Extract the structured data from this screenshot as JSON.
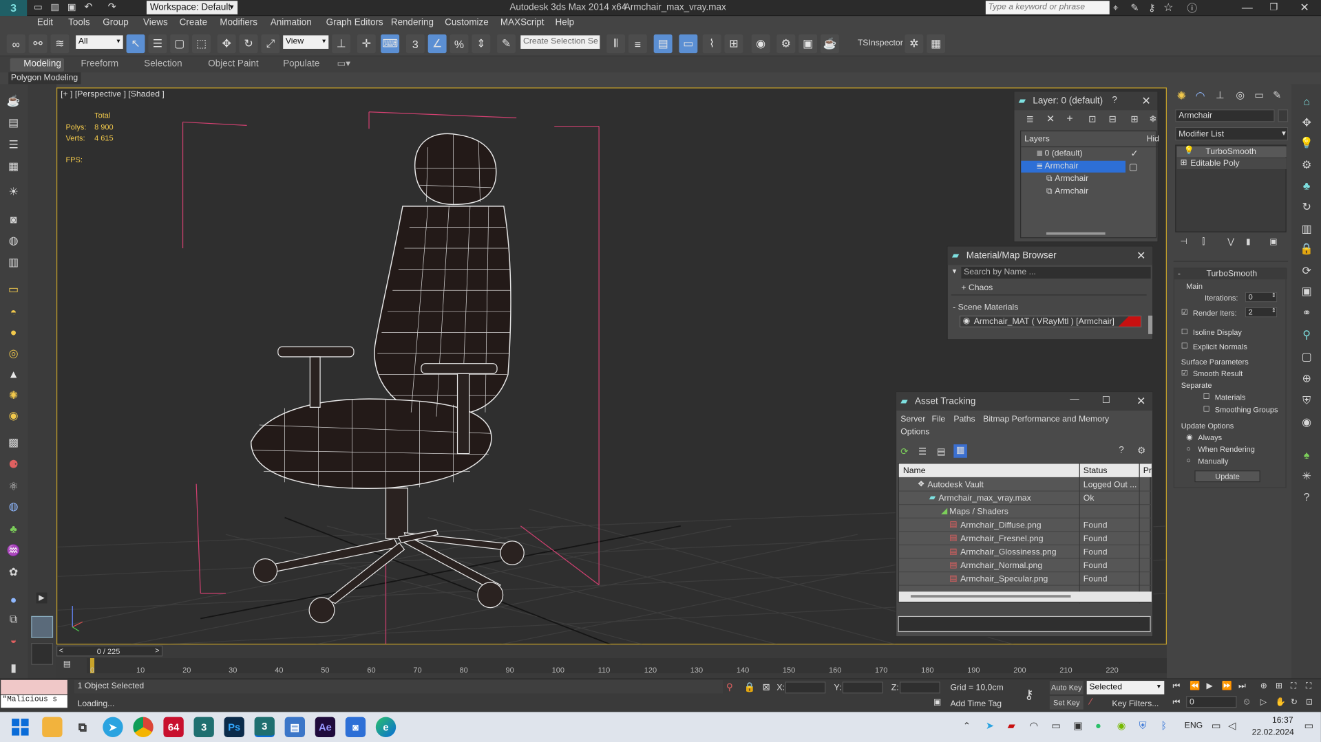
{
  "app": {
    "workspace_label": "Workspace: Default",
    "window_title": "Autodesk 3ds Max  2014 x64",
    "file_title": "Armchair_max_vray.max",
    "search_placeholder": "Type a keyword or phrase"
  },
  "menu": [
    "Edit",
    "Tools",
    "Group",
    "Views",
    "Create",
    "Modifiers",
    "Animation",
    "Graph Editors",
    "Rendering",
    "Customize",
    "MAXScript",
    "Help"
  ],
  "toolbar": {
    "selection_filter": "All",
    "ref_coord": "View",
    "selection_set": "Create Selection Se",
    "tsinspector": "TSInspector"
  },
  "ribbon": {
    "tabs": [
      "Modeling",
      "Freeform",
      "Selection",
      "Object Paint",
      "Populate"
    ],
    "sub_label": "Polygon Modeling"
  },
  "viewport": {
    "label": "[+ ] [Perspective ] [Shaded ]",
    "stats_total": "Total",
    "polys_label": "Polys:",
    "polys_value": "8 900",
    "verts_label": "Verts:",
    "verts_value": "4 615",
    "fps_label": "FPS:"
  },
  "layer_panel": {
    "title": "Layer: 0 (default)",
    "help": "?",
    "col_layers": "Layers",
    "col_hide": "Hid",
    "items": [
      "0 (default)",
      "Armchair",
      "Armchair",
      "Armchair"
    ]
  },
  "material_browser": {
    "title": "Material/Map Browser",
    "search_placeholder": "Search by Name ...",
    "group_chaos": "+ Chaos",
    "group_scene": "- Scene Materials",
    "material_item": "Armchair_MAT ( VRayMtl ) [Armchair]"
  },
  "asset_tracking": {
    "title": "Asset Tracking",
    "menu": [
      "Server",
      "File",
      "Paths",
      "Bitmap Performance and Memory"
    ],
    "menu_options": "Options",
    "col_name": "Name",
    "col_status": "Status",
    "col_pr": "Pr",
    "rows": [
      {
        "name": "Autodesk Vault",
        "status": "Logged Out ..."
      },
      {
        "name": "Armchair_max_vray.max",
        "status": "Ok"
      },
      {
        "name": "Maps / Shaders",
        "status": ""
      },
      {
        "name": "Armchair_Diffuse.png",
        "status": "Found"
      },
      {
        "name": "Armchair_Fresnel.png",
        "status": "Found"
      },
      {
        "name": "Armchair_Glossiness.png",
        "status": "Found"
      },
      {
        "name": "Armchair_Normal.png",
        "status": "Found"
      },
      {
        "name": "Armchair_Specular.png",
        "status": "Found"
      }
    ]
  },
  "command_panel": {
    "object_name": "Armchair",
    "modifier_list": "Modifier List",
    "stack": [
      "TurboSmooth",
      "Editable Poly"
    ],
    "rollout_title": "TurboSmooth",
    "main_label": "Main",
    "iterations_label": "Iterations:",
    "iterations_value": "0",
    "render_iters_label": "Render Iters:",
    "render_iters_value": "2",
    "isoline": "Isoline Display",
    "explicit_normals": "Explicit Normals",
    "surface_params": "Surface Parameters",
    "smooth_result": "Smooth Result",
    "separate": "Separate",
    "materials": "Materials",
    "smoothing_groups": "Smoothing Groups",
    "update_options": "Update Options",
    "always": "Always",
    "when_rendering": "When Rendering",
    "manually": "Manually",
    "update_button": "Update"
  },
  "timeline": {
    "frame_counter": "0 / 225",
    "ticks": [
      "0",
      "10",
      "20",
      "30",
      "40",
      "50",
      "60",
      "70",
      "80",
      "90",
      "100",
      "110",
      "120",
      "130",
      "140",
      "150",
      "160",
      "170",
      "180",
      "190",
      "200",
      "210",
      "220"
    ]
  },
  "status": {
    "script_field": "\"Malicious s",
    "objects_selected": "1 Object Selected",
    "loading": "Loading...",
    "x_label": "X:",
    "y_label": "Y:",
    "z_label": "Z:",
    "grid": "Grid = 10,0cm",
    "auto_key": "Auto Key",
    "selected": "Selected",
    "set_key": "Set Key",
    "key_filters": "Key Filters...",
    "add_time_tag": "Add Time Tag",
    "frame_value": "0"
  },
  "taskbar": {
    "lang": "ENG",
    "time": "16:37",
    "date": "22.02.2024",
    "badge_64": "64",
    "ps": "Ps",
    "ae": "Ae"
  }
}
